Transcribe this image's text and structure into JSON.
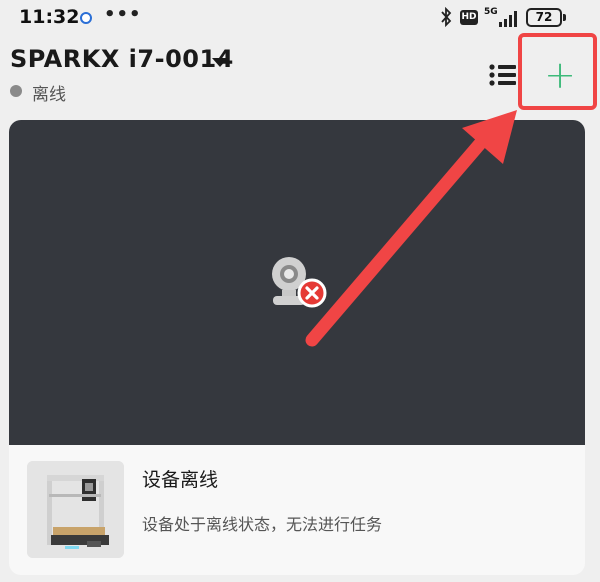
{
  "status_bar": {
    "time": "11:32",
    "more": "•••",
    "hd": "HD",
    "network": "5G",
    "battery": "72",
    "icons": [
      "notification-dot-icon",
      "bluetooth-icon",
      "hd-icon",
      "signal-icon",
      "battery-icon"
    ]
  },
  "header": {
    "device_name": "SPARKX i7-0014",
    "status": "离线",
    "status_color": "#8a8a8a",
    "add_label": "+",
    "add_color": "#3dba7a"
  },
  "camera": {
    "icon": "camera-offline-icon",
    "background": "#35383e"
  },
  "device_info": {
    "title": "设备离线",
    "description": "设备处于离线状态，无法进行任务"
  },
  "annotation": {
    "color": "#f04545"
  }
}
